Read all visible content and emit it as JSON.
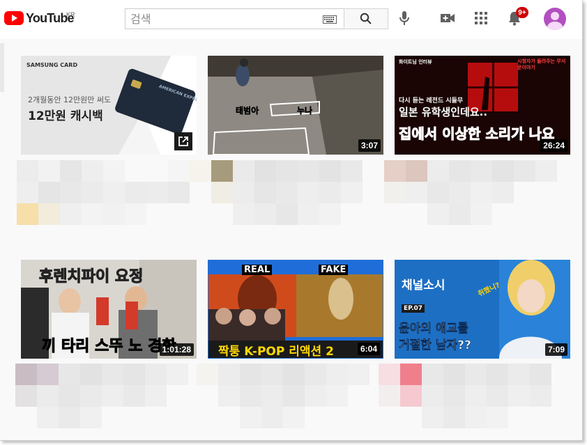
{
  "header": {
    "logo_text": "YouTube",
    "region": "KR",
    "search_placeholder": "검색"
  },
  "badge_count": "9+",
  "colors": {
    "brand": "#ff0000",
    "badge": "#cc0000",
    "avatar": "#b34fc1"
  },
  "videos": [
    {
      "duration": "",
      "overlay": [
        "SAMSUNG CARD",
        "2개월동안 12만원만 써도",
        "12만원 캐시백",
        "AMERICAN EXPRESS"
      ]
    },
    {
      "duration": "3:07",
      "overlay": [
        "태범아",
        "누나"
      ]
    },
    {
      "duration": "26:24",
      "overlay": [
        "화이트님 인터뷰",
        "시청자가 들려주는 무서운이야기",
        "다시 듣는 레전드 시들무",
        "일본 유학생인데요..",
        "집에서 이상한 소리가 나요"
      ]
    },
    {
      "duration": "1:01:28",
      "overlay": [
        "후렌치파이 요정",
        "끼 타리 스뚜 노 경한"
      ]
    },
    {
      "duration": "6:04",
      "overlay": [
        "REAL",
        "FAKE",
        "짝퉁 K-POP 리액션 2"
      ]
    },
    {
      "duration": "7:09",
      "overlay": [
        "채널소시",
        "EP.07",
        "윤아의 애교를",
        "거절한 남자??",
        "취했니?"
      ]
    }
  ]
}
